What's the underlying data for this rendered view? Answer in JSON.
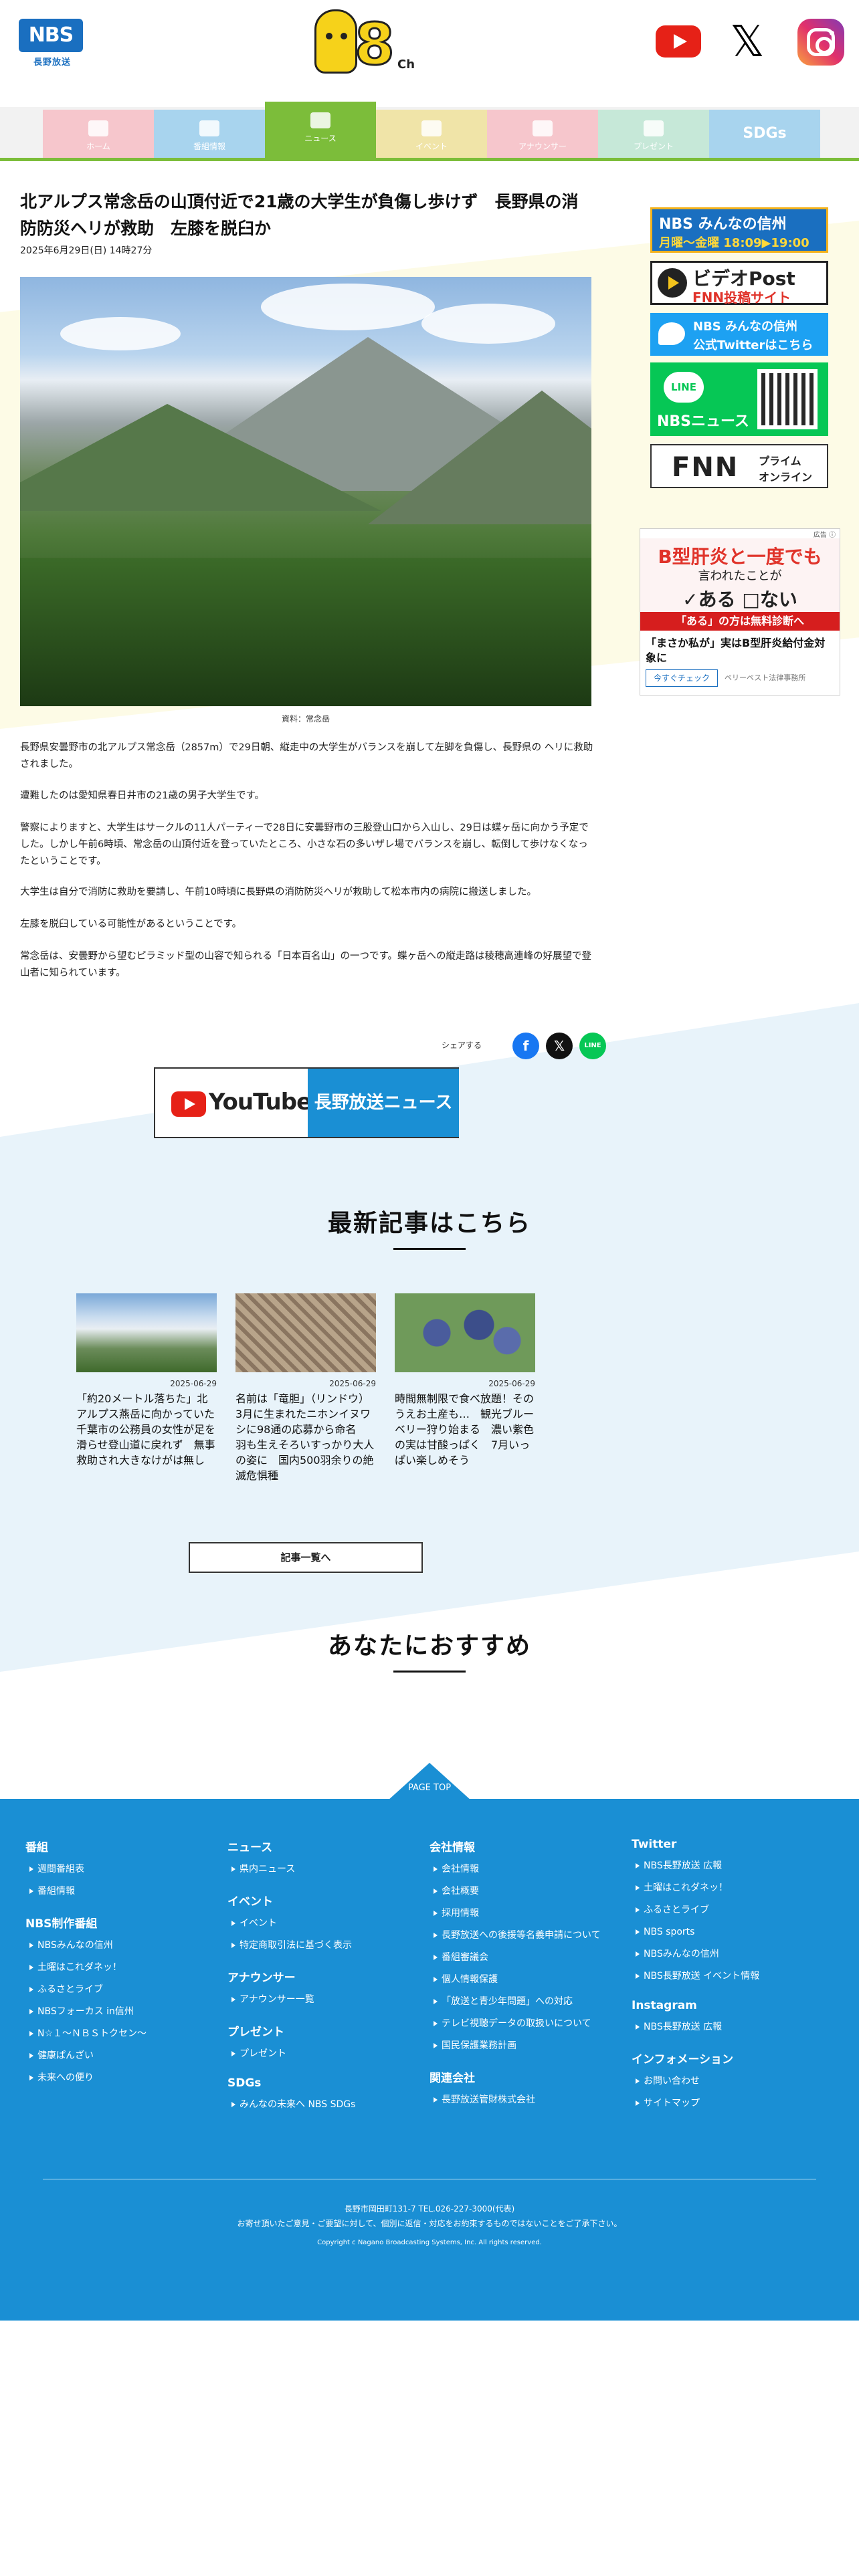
{
  "header": {
    "logo_nbs": "NBS",
    "logo_nbs_sub": "長野放送",
    "logo_8ch": "8",
    "logo_8ch_suffix": "Ch"
  },
  "nav": {
    "tabs": [
      {
        "label": "ホーム",
        "color": "#f6c6cc"
      },
      {
        "label": "番組情報",
        "color": "#a8d4ee"
      },
      {
        "label": "ニュース",
        "color": "#7cbd3a"
      },
      {
        "label": "イベント",
        "color": "#f0e4a8"
      },
      {
        "label": "アナウンサー",
        "color": "#f6c6cc"
      },
      {
        "label": "プレゼント",
        "color": "#c6e8d8"
      },
      {
        "label": "SDGs",
        "color": "#a8d4ee"
      }
    ]
  },
  "article": {
    "title": "北アルプス常念岳の山頂付近で21歳の大学生が負傷し歩けず　長野県の消防防災ヘリが救助　左膝を脱臼か",
    "date": "2025年6月29日(日) 14時27分",
    "caption": "資料：常念岳",
    "paragraphs": [
      "長野県安曇野市の北アルプス常念岳（2857m）で29日朝、縦走中の大学生がバランスを崩して左脚を負傷し、長野県の ヘリに救助されました。",
      "遭難したのは愛知県春日井市の21歳の男子大学生です。",
      "警察によりますと、大学生はサークルの11人パーティーで28日に安曇野市の三股登山口から入山し、29日は蝶ヶ岳に向かう予定でした。しかし午前6時頃、常念岳の山頂付近を登っていたところ、小さな石の多いザレ場でバランスを崩し、転倒して歩けなくなったということです。",
      "大学生は自分で消防に救助を要請し、午前10時頃に長野県の消防防災ヘリが救助して松本市内の病院に搬送しました。",
      "左膝を脱臼している可能性があるということです。",
      "常念岳は、安曇野から望むピラミッド型の山容で知られる「日本百名山」の一つです。蝶ヶ岳への縦走路は稜穂高連峰の好展望で登山者に知られています。"
    ]
  },
  "share": {
    "label": "シェアする",
    "fb": "f",
    "x": "𝕏",
    "line": "LINE"
  },
  "youtube_banner": {
    "logo": "YouTube",
    "channel": "長野放送ニュース"
  },
  "latest": {
    "title": "最新記事はこちら",
    "cards": [
      {
        "date": "2025-06-29",
        "text": "「約20メートル落ちた」北アルプス燕岳に向かっていた千葉市の公務員の女性が足を滑らせ登山道に戻れず　無事救助され大きなけがは無し"
      },
      {
        "date": "2025-06-29",
        "text": "名前は「竜胆」（リンドウ） 3月に生まれたニホンイヌワシに98通の応募から命名　羽も生えそろいすっかり大人の姿に　国内500羽余りの絶滅危惧種"
      },
      {
        "date": "2025-06-29",
        "text": "時間無制限で食べ放題！そのうえお土産も…　観光ブルーベリー狩り始まる　濃い紫色の実は甘酸っぱく　7月いっぱい楽しめそう"
      }
    ],
    "more_button": "記事一覧へ"
  },
  "recommend": {
    "title": "あなたにおすすめ"
  },
  "sidebar": {
    "b1_line1": "NBS みんなの信州",
    "b1_line2": "月曜～金曜 18:09▶19:00",
    "b2_line1": "ビデオPost",
    "b2_line2": "FNN投稿サイト",
    "b3_line1": "NBS みんなの信州",
    "b3_line2": "公式Twitterはこちら",
    "b4_line": "LINE",
    "b4_nbs": "NBSニュース",
    "b5_logo": "FNN",
    "b5_line1": "プライム",
    "b5_line2": "オンライン",
    "ad_label": "広告 ⓘ",
    "ad_h1": "B型肝炎と一度でも",
    "ad_h2": "言われたことが",
    "ad_h3": "✓ある □ない",
    "ad_band": "「ある」の方は無料診断へ",
    "ad_text": "「まさか私が」実はB型肝炎給付金対象に",
    "ad_button": "今すぐチェック",
    "ad_by": "ベリーベスト法律事務所"
  },
  "footer": {
    "pagetop": "PAGE TOP",
    "col1": [
      {
        "h": "番組",
        "items": [
          "週間番組表",
          "番組情報"
        ]
      },
      {
        "h": "NBS制作番組",
        "items": [
          "NBSみんなの信州",
          "土曜はこれダネッ！",
          "ふるさとライブ",
          "NBSフォーカス in信州",
          "N☆１～ＮＢＳトクセン～",
          "健康ぱんざい",
          "未来への便り"
        ]
      }
    ],
    "col2": [
      {
        "h": "ニュース",
        "items": [
          "県内ニュース"
        ]
      },
      {
        "h": "イベント",
        "items": [
          "イベント",
          "特定商取引法に基づく表示"
        ]
      },
      {
        "h": "アナウンサー",
        "items": [
          "アナウンサー一覧"
        ]
      },
      {
        "h": "プレゼント",
        "items": [
          "プレゼント"
        ]
      },
      {
        "h": "SDGs",
        "items": [
          "みんなの未来へ NBS SDGs"
        ]
      }
    ],
    "col3": [
      {
        "h": "会社情報",
        "items": [
          "会社情報",
          "会社概要",
          "採用情報",
          "長野放送への後援等名義申請について",
          "番組審議会",
          "個人情報保護",
          "「放送と青少年問題」への対応",
          "テレビ視聴データの取扱いについて",
          "国民保護業務計画"
        ]
      },
      {
        "h": "関連会社",
        "items": [
          "長野放送管財株式会社"
        ]
      }
    ],
    "col4": [
      {
        "h": "Twitter",
        "items": [
          "NBS長野放送 広報",
          "土曜はこれダネッ！",
          "ふるさとライブ",
          "NBS sports",
          "NBSみんなの信州",
          "NBS長野放送 イベント情報"
        ]
      },
      {
        "h": "Instagram",
        "items": [
          "NBS長野放送 広報"
        ]
      },
      {
        "h": "インフォメーション",
        "items": [
          "お問い合わせ",
          "サイトマップ"
        ]
      }
    ],
    "address": "長野市岡田町131-7 TEL.026-227-3000(代表)",
    "notice": "お寄せ頂いたご意見・ご要望に対して、個別に返信・対応をお約束するものではないことをご了承下さい。",
    "copyright": "Copyright c Nagano Broadcasting Systems, Inc. All rights reserved."
  }
}
